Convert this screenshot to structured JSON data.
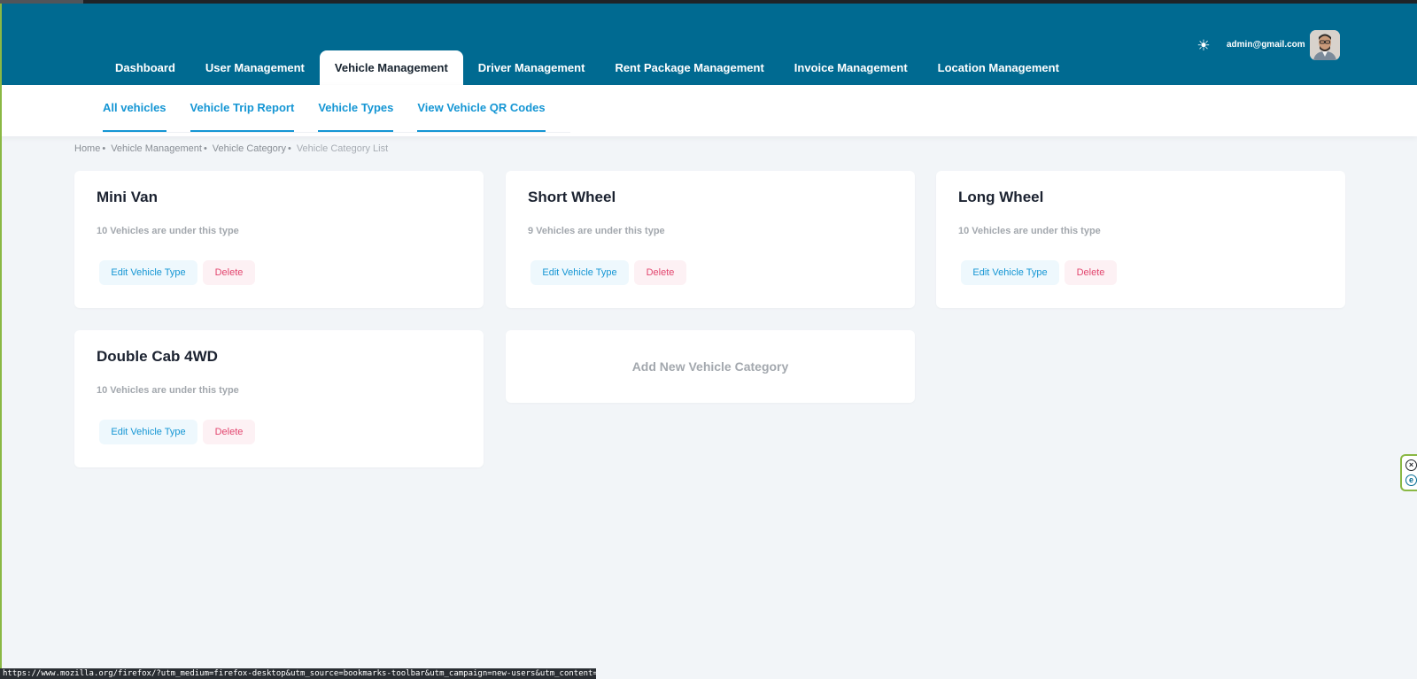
{
  "nav": {
    "items": [
      {
        "label": "Dashboard"
      },
      {
        "label": "User Management"
      },
      {
        "label": "Vehicle Management",
        "active": true
      },
      {
        "label": "Driver Management"
      },
      {
        "label": "Rent Package Management"
      },
      {
        "label": "Invoice Management"
      },
      {
        "label": "Location Management"
      }
    ]
  },
  "user": {
    "email": "admin@gmail.com"
  },
  "icons": {
    "theme": "sun-icon",
    "avatar": "user-avatar",
    "widget_close": "close-icon",
    "widget_ext": "extension-icon"
  },
  "subnav": {
    "links": [
      {
        "label": "All vehicles"
      },
      {
        "label": "Vehicle Trip Report"
      },
      {
        "label": "Vehicle Types"
      },
      {
        "label": "View Vehicle QR Codes"
      }
    ]
  },
  "breadcrumb": {
    "items": [
      {
        "label": "Home"
      },
      {
        "label": "Vehicle Management"
      },
      {
        "label": "Vehicle Category"
      },
      {
        "label": "Vehicle Category List"
      }
    ],
    "separator": "•"
  },
  "categories": [
    {
      "title": "Mini Van",
      "subtitle": "10 Vehicles are under this type",
      "edit_label": "Edit Vehicle Type",
      "delete_label": "Delete"
    },
    {
      "title": "Short Wheel",
      "subtitle": "9 Vehicles are under this type",
      "edit_label": "Edit Vehicle Type",
      "delete_label": "Delete"
    },
    {
      "title": "Long Wheel",
      "subtitle": "10 Vehicles are under this type",
      "edit_label": "Edit Vehicle Type",
      "delete_label": "Delete"
    },
    {
      "title": "Double Cab 4WD",
      "subtitle": "10 Vehicles are under this type",
      "edit_label": "Edit Vehicle Type",
      "delete_label": "Delete"
    }
  ],
  "add_card": {
    "label": "Add New Vehicle Category"
  },
  "status_bar": {
    "url": "https://www.mozilla.org/firefox/?utm_medium=firefox-desktop&utm_source=bookmarks-toolbar&utm_campaign=new-users&utm_content=-global"
  },
  "colors": {
    "header_bg": "#006a91",
    "link": "#1596d4",
    "delete": "#e2456e",
    "page_bg": "#f2f5f8"
  }
}
